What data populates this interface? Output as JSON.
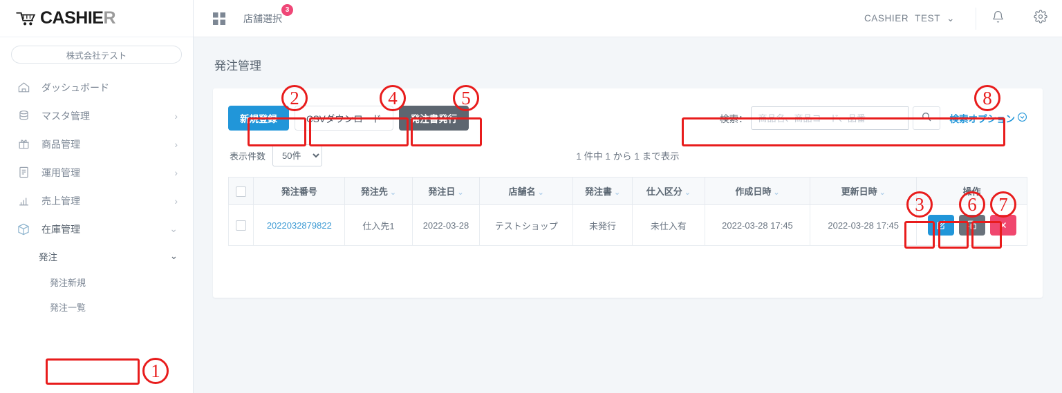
{
  "brand": {
    "name_main": "CASHIE",
    "name_accent": "R",
    "icon": "shopping-cart-icon"
  },
  "sidebar": {
    "company": "株式会社テスト",
    "items": [
      {
        "label": "ダッシュボード",
        "icon": "home-icon",
        "chevron": ""
      },
      {
        "label": "マスタ管理",
        "icon": "database-icon",
        "chevron": "›"
      },
      {
        "label": "商品管理",
        "icon": "gift-icon",
        "chevron": "›"
      },
      {
        "label": "運用管理",
        "icon": "document-icon",
        "chevron": "›"
      },
      {
        "label": "売上管理",
        "icon": "bar-chart-icon",
        "chevron": "›"
      },
      {
        "label": "在庫管理",
        "icon": "box-icon",
        "chevron": "⌄"
      }
    ],
    "sub_group": {
      "label": "発注",
      "chevron": "⌄"
    },
    "sub_items": [
      {
        "label": "発注新規"
      },
      {
        "label": "発注一覧"
      }
    ]
  },
  "topbar": {
    "grid_icon": "grid-icon",
    "store_select": "店舗選択",
    "store_badge": "3",
    "user_org": "CASHIER",
    "user_name": "TEST",
    "user_chevron": "⌄",
    "bell_icon": "bell-icon",
    "gear_icon": "gear-icon"
  },
  "page": {
    "title": "発注管理"
  },
  "toolbar": {
    "new_label": "新規登録",
    "csv_label": "CSVダウンロード",
    "issue_label": "発注書発行"
  },
  "search": {
    "label": "検索：",
    "value": "",
    "placeholder": "商品名、商品コード、品番",
    "search_icon": "search-icon",
    "options_label": "検索オプション",
    "options_chevron": "⌄"
  },
  "list_controls": {
    "length_label": "表示件数",
    "length_value": "50件",
    "length_options": [
      "50件"
    ],
    "count_info": "1 件中 1 から 1 まで表示"
  },
  "table": {
    "columns": [
      {
        "label": "",
        "sortable": false,
        "key": "checkbox"
      },
      {
        "label": "発注番号",
        "sortable": false
      },
      {
        "label": "発注先",
        "sortable": true
      },
      {
        "label": "発注日",
        "sortable": true
      },
      {
        "label": "店舗名",
        "sortable": true
      },
      {
        "label": "発注書",
        "sortable": true
      },
      {
        "label": "仕入区分",
        "sortable": true
      },
      {
        "label": "作成日時",
        "sortable": true
      },
      {
        "label": "更新日時",
        "sortable": true
      },
      {
        "label": "操作",
        "sortable": false
      }
    ],
    "sort_glyph": "⌄",
    "rows": [
      {
        "order_number": "2022032879822",
        "supplier": "仕入先1",
        "order_date": "2022-03-28",
        "shop": "テストショップ",
        "order_sheet": "未発行",
        "purchase_type": "未仕入有",
        "created_at": "2022-03-28 17:45",
        "updated_at": "2022-03-28 17:45",
        "actions": [
          {
            "name": "edit-row-button",
            "icon": "edit-icon",
            "color": "#2196d9"
          },
          {
            "name": "copy-row-button",
            "icon": "copy-icon",
            "color": "#6a727b"
          },
          {
            "name": "delete-row-button",
            "icon": "close-icon",
            "color": "#f0476e"
          }
        ]
      }
    ]
  },
  "annotations": {
    "color": "#e81c1c",
    "markers": [
      {
        "id": "1",
        "label": "1"
      },
      {
        "id": "2",
        "label": "2"
      },
      {
        "id": "3",
        "label": "3"
      },
      {
        "id": "4",
        "label": "4"
      },
      {
        "id": "5",
        "label": "5"
      },
      {
        "id": "6",
        "label": "6"
      },
      {
        "id": "7",
        "label": "7"
      },
      {
        "id": "8",
        "label": "8"
      }
    ]
  }
}
